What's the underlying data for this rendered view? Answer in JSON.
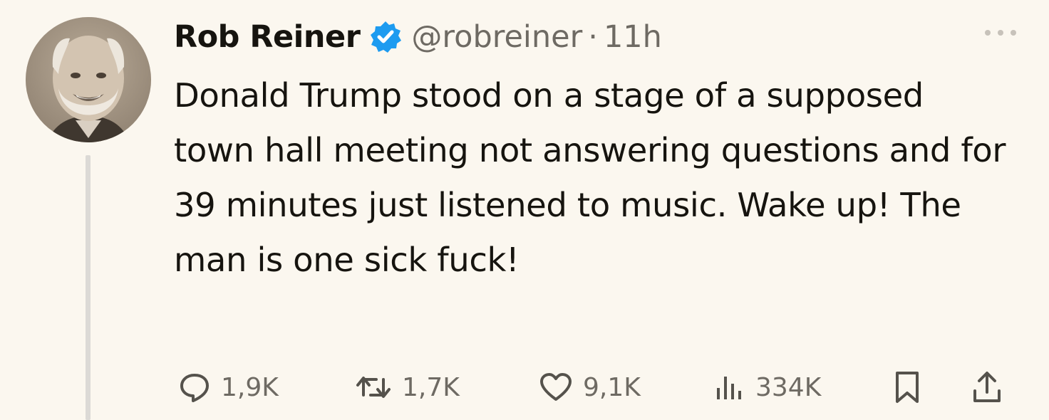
{
  "author": {
    "name": "Rob Reiner",
    "handle": "@robreiner",
    "separator": "·",
    "time": "11h",
    "verified": true,
    "verified_color": "#1d9bf0"
  },
  "tweet": {
    "text": "Donald Trump stood on a stage of a supposed town hall meeting not answering questions and for 39 minutes just listened to music. Wake up! The man is one sick fuck!"
  },
  "actions": {
    "reply_count": "1,9K",
    "repost_count": "1,7K",
    "like_count": "9,1K",
    "views_count": "334K"
  },
  "icons": {
    "reply": "reply-icon",
    "repost": "repost-icon",
    "like": "heart-icon",
    "views": "views-icon",
    "bookmark": "bookmark-icon",
    "share": "share-icon",
    "more": "more-icon"
  }
}
